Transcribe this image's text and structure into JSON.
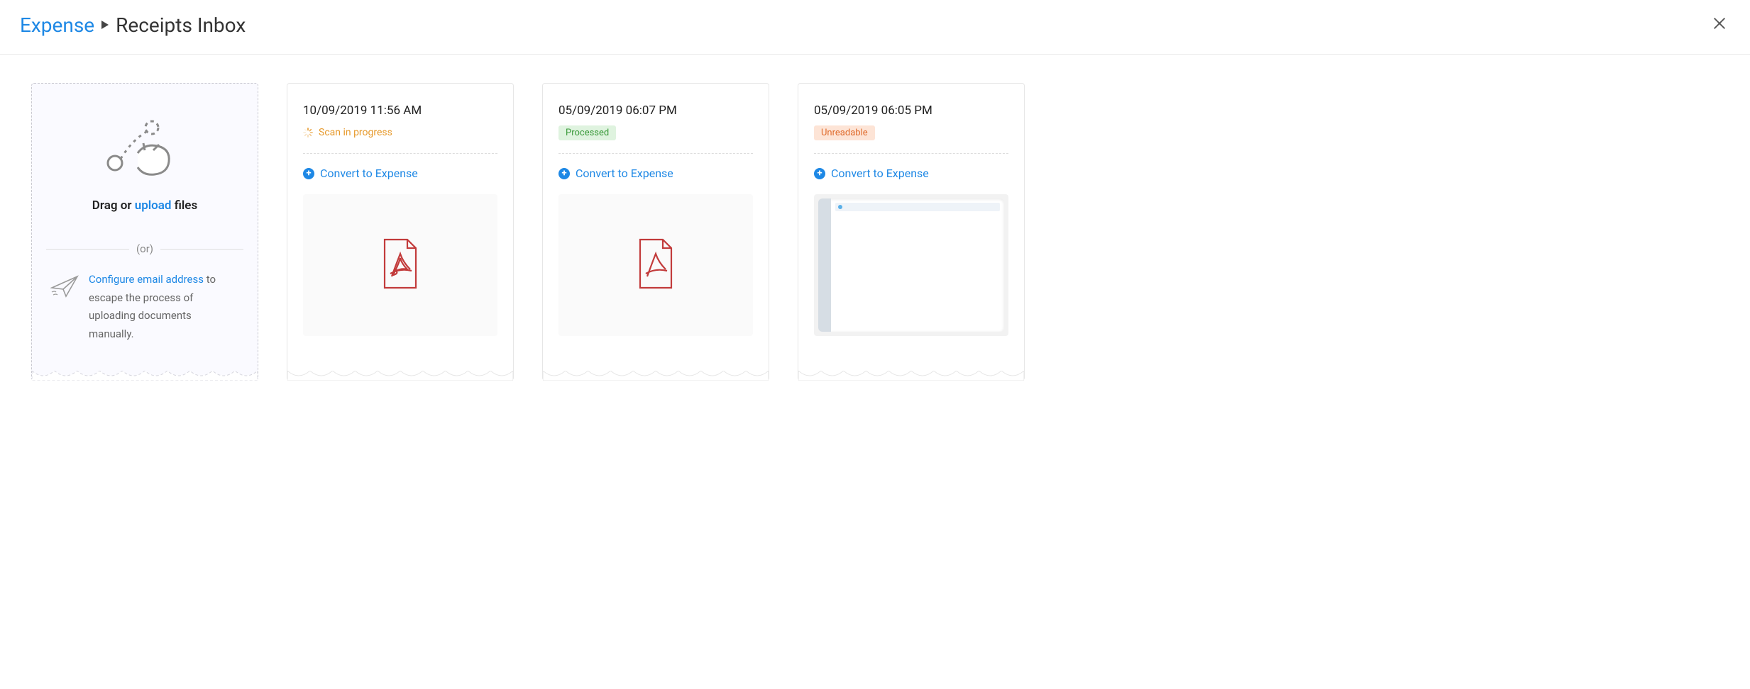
{
  "breadcrumb": {
    "root": "Expense",
    "current": "Receipts Inbox"
  },
  "upload": {
    "drag_prefix": "Drag or ",
    "upload_word": "upload",
    "drag_suffix": " files",
    "or_label": "(or)",
    "config_link": "Configure email address",
    "config_rest": " to escape the process of uploading documents manually."
  },
  "receipts": [
    {
      "date": "10/09/2019 11:56 AM",
      "status_type": "scanning",
      "status_label": "Scan in progress",
      "convert_label": "Convert to Expense",
      "preview": "pdf"
    },
    {
      "date": "05/09/2019 06:07 PM",
      "status_type": "processed",
      "status_label": "Processed",
      "convert_label": "Convert to Expense",
      "preview": "pdf"
    },
    {
      "date": "05/09/2019 06:05 PM",
      "status_type": "unreadable",
      "status_label": "Unreadable",
      "convert_label": "Convert to Expense",
      "preview": "screenshot"
    }
  ]
}
